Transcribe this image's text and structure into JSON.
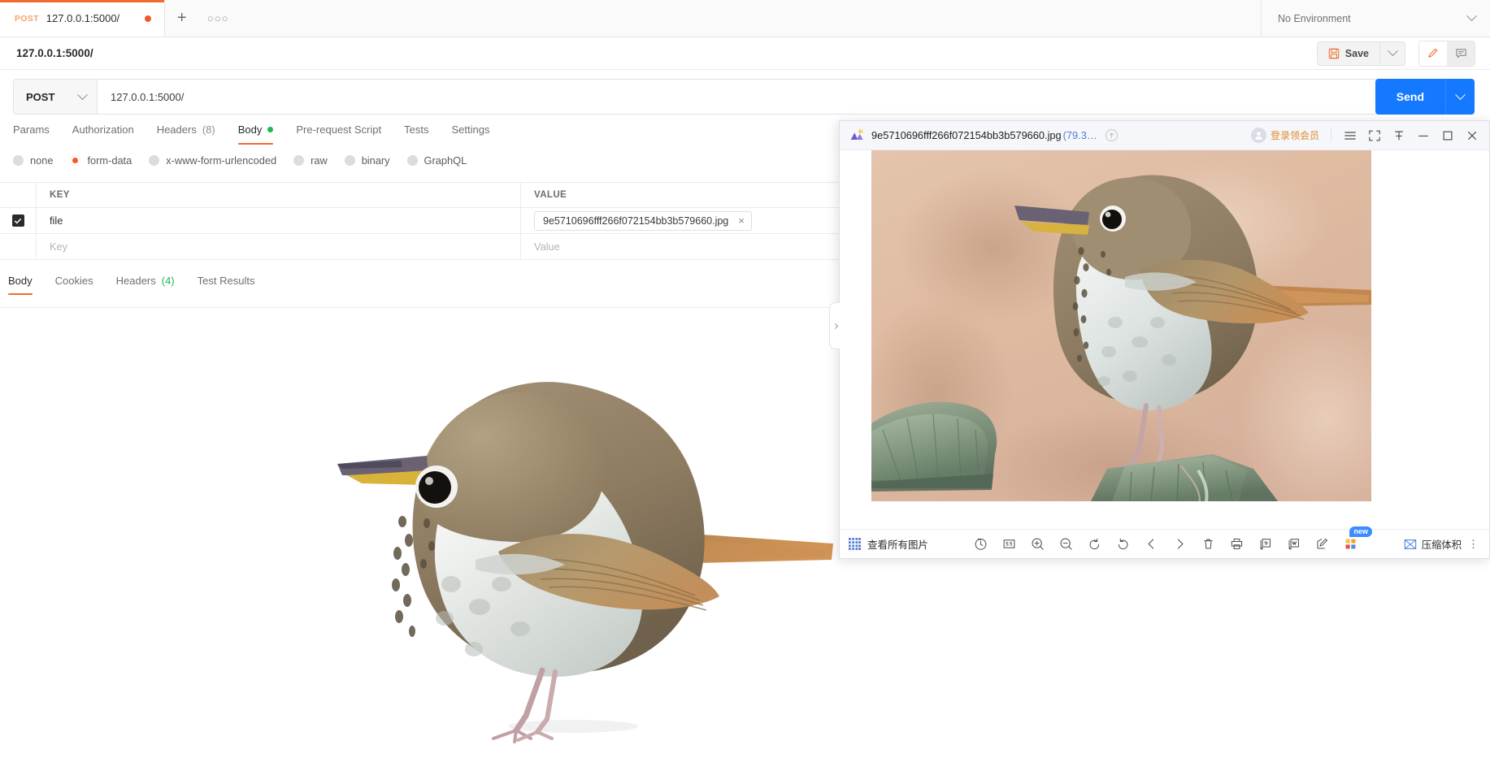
{
  "tabstrip": {
    "tab": {
      "method": "POST",
      "title": "127.0.0.1:5000/",
      "unsaved_dot": "●"
    },
    "new_tab_label": "+",
    "more_label": "○○○",
    "environment": {
      "label": "No Environment"
    }
  },
  "crumbrow": {
    "title": "127.0.0.1:5000/",
    "save_label": "Save"
  },
  "urlbar": {
    "method": "POST",
    "url": "127.0.0.1:5000/",
    "send_label": "Send"
  },
  "request_tabs": [
    {
      "label": "Params",
      "active": false
    },
    {
      "label": "Authorization",
      "active": false
    },
    {
      "label": "Headers",
      "count": "(8)",
      "active": false
    },
    {
      "label": "Body",
      "active": true,
      "dot": true
    },
    {
      "label": "Pre-request Script",
      "active": false
    },
    {
      "label": "Tests",
      "active": false
    },
    {
      "label": "Settings",
      "active": false
    }
  ],
  "body_types": [
    {
      "label": "none",
      "selected": false
    },
    {
      "label": "form-data",
      "selected": true
    },
    {
      "label": "x-www-form-urlencoded",
      "selected": false
    },
    {
      "label": "raw",
      "selected": false
    },
    {
      "label": "binary",
      "selected": false
    },
    {
      "label": "GraphQL",
      "selected": false
    }
  ],
  "kvtable": {
    "headers": {
      "key": "KEY",
      "value": "VALUE"
    },
    "rows": [
      {
        "checked": true,
        "key": "file",
        "value": "9e5710696fff266f072154bb3b579660.jpg",
        "is_file": true,
        "remove": "×"
      }
    ],
    "placeholder_row": {
      "key": "Key",
      "value": "Value"
    }
  },
  "response_tabs": [
    {
      "label": "Body",
      "active": true
    },
    {
      "label": "Cookies",
      "active": false
    },
    {
      "label": "Headers",
      "count": "(4)",
      "active": false
    },
    {
      "label": "Test Results",
      "active": false
    }
  ],
  "viewer": {
    "filename": "9e5710696fff266f072154bb3b579660.jpg",
    "filesize": "(79.3…",
    "member_label": "登录领会员",
    "all_images_label": "查看所有图片",
    "compress_label": "压缩体积",
    "new_badge": "new",
    "kebab": "⋮",
    "window_controls": {
      "menu": "menu-icon",
      "fullscreen": "fullscreen-icon",
      "pin": "pin-icon",
      "minimize": "—",
      "maximize": "□",
      "close": "✕"
    },
    "tools": [
      "rotate-clock-icon",
      "actual-size-icon",
      "zoom-in-icon",
      "zoom-out-icon",
      "rotate-left-icon",
      "rotate-right-icon",
      "prev-icon",
      "next-icon",
      "delete-icon",
      "print-icon",
      "convert-pdf-icon",
      "convert-word-icon",
      "edit-icon",
      "more-tools-icon"
    ]
  },
  "colors": {
    "accent_orange": "#ef6c2e",
    "send_blue": "#1479ff",
    "green_dot": "#1db954",
    "member_orange": "#e08a2e"
  }
}
